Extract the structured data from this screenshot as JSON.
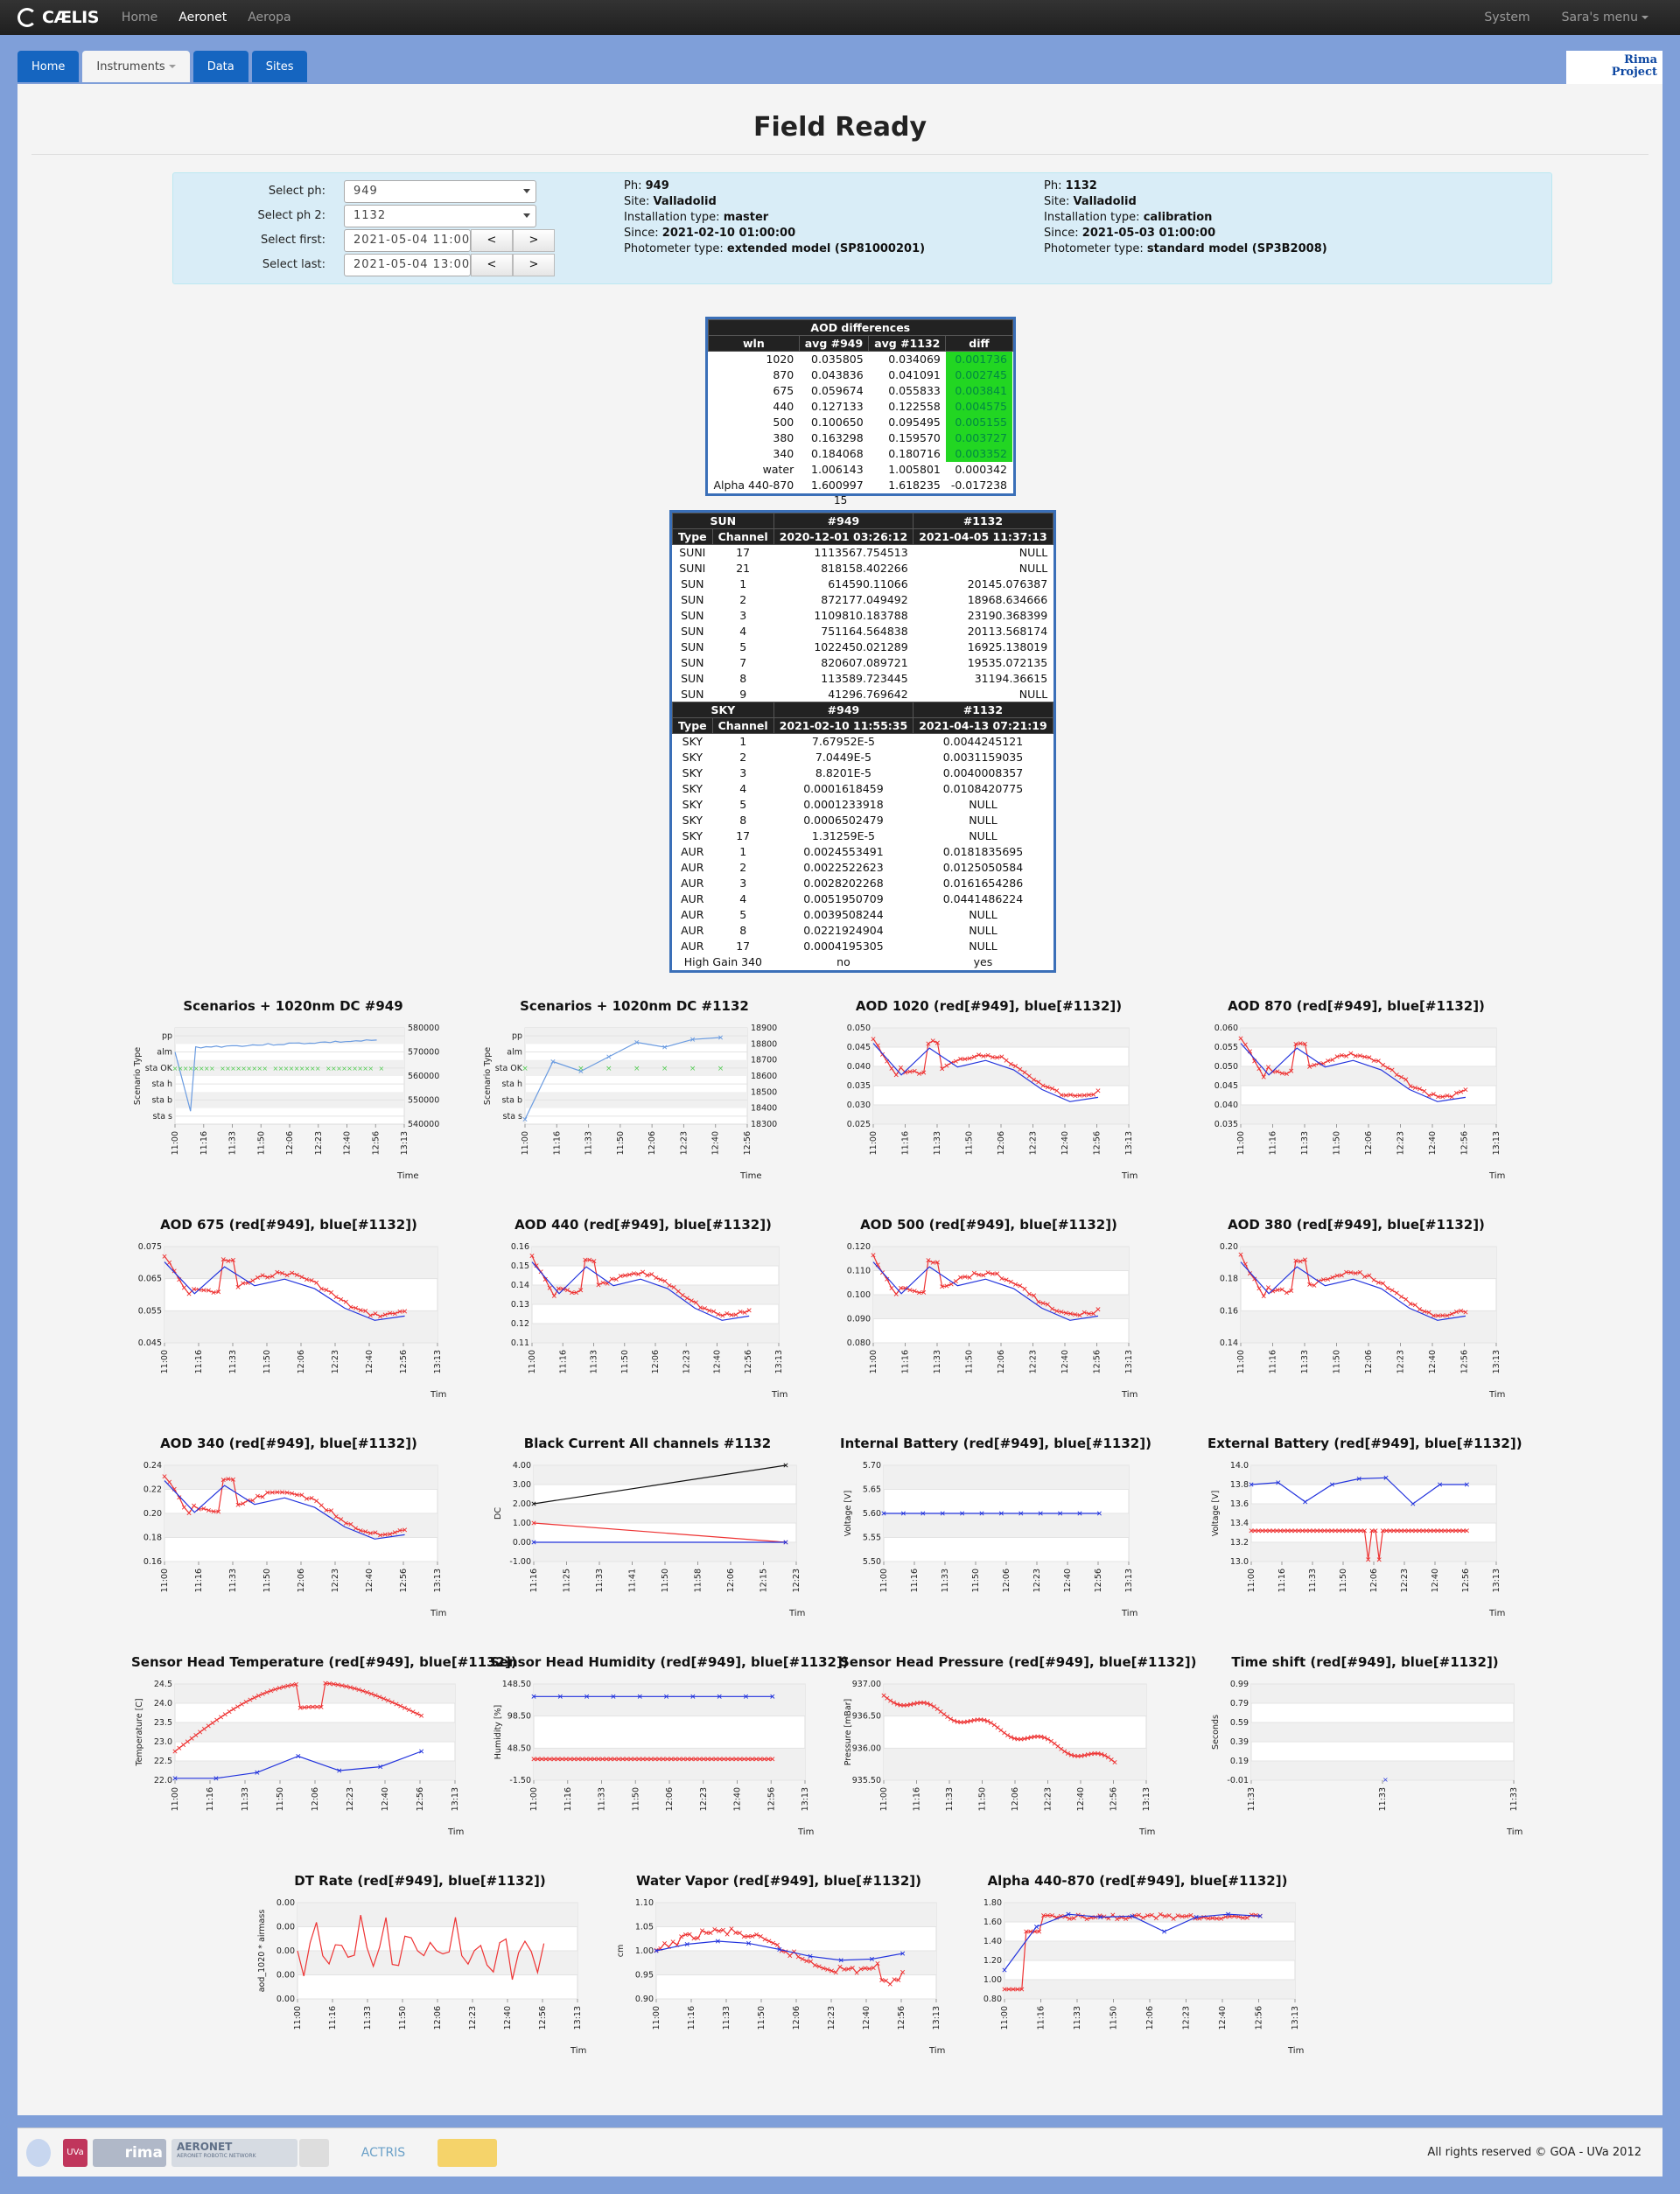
{
  "nav": {
    "brand": "CÆLIS",
    "items": [
      "Home",
      "Aeronet",
      "Aeropa"
    ],
    "right": [
      "System",
      "Sara's menu"
    ]
  },
  "tabs": [
    "Home",
    "Instruments",
    "Data",
    "Sites"
  ],
  "rima": [
    "Rima",
    "Project"
  ],
  "title": "Field Ready",
  "form": {
    "ph_label": "Select ph:",
    "ph": "949",
    "ph2_label": "Select ph 2:",
    "ph2": "1132",
    "first_label": "Select first:",
    "first": "2021-05-04 11:00:00",
    "last_label": "Select last:",
    "last": "2021-05-04 13:00:00",
    "prev": "<",
    "next": ">"
  },
  "ph1": {
    "ph_l": "Ph:",
    "ph": "949",
    "site_l": "Site:",
    "site": "Valladolid",
    "inst_l": "Installation type:",
    "inst": "master",
    "since_l": "Since:",
    "since": "2021-02-10 01:00:00",
    "type_l": "Photometer type:",
    "type": "extended model (SP81000201)"
  },
  "ph2": {
    "ph_l": "Ph:",
    "ph": "1132",
    "site_l": "Site:",
    "site": "Valladolid",
    "inst_l": "Installation type:",
    "inst": "calibration",
    "since_l": "Since:",
    "since": "2021-05-03 01:00:00",
    "type_l": "Photometer type:",
    "type": "standard model (SP3B2008)"
  },
  "aod_table": {
    "title": "AOD differences",
    "headers": [
      "wln",
      "avg #949",
      "avg #1132",
      "diff"
    ],
    "rows": [
      [
        "1020",
        "0.035805",
        "0.034069",
        "0.001736",
        true
      ],
      [
        "870",
        "0.043836",
        "0.041091",
        "0.002745",
        true
      ],
      [
        "675",
        "0.059674",
        "0.055833",
        "0.003841",
        true
      ],
      [
        "440",
        "0.127133",
        "0.122558",
        "0.004575",
        true
      ],
      [
        "500",
        "0.100650",
        "0.095495",
        "0.005155",
        true
      ],
      [
        "380",
        "0.163298",
        "0.159570",
        "0.003727",
        true
      ],
      [
        "340",
        "0.184068",
        "0.180716",
        "0.003352",
        true
      ],
      [
        "water",
        "1.006143",
        "1.005801",
        "0.000342",
        false
      ],
      [
        "Alpha 440-870",
        "1.600997",
        "1.618235",
        "-0.017238",
        false
      ]
    ]
  },
  "count": "15",
  "sun_table": {
    "h1": [
      "SUN",
      "#949",
      "#1132"
    ],
    "h2": [
      "Type",
      "Channel",
      "2020-12-01 03:26:12",
      "2021-04-05 11:37:13"
    ],
    "rows": [
      [
        "SUNI",
        "17",
        "1113567.754513",
        "NULL"
      ],
      [
        "SUNI",
        "21",
        "818158.402266",
        "NULL"
      ],
      [
        "SUN",
        "1",
        "614590.11066",
        "20145.076387"
      ],
      [
        "SUN",
        "2",
        "872177.049492",
        "18968.634666"
      ],
      [
        "SUN",
        "3",
        "1109810.183788",
        "23190.368399"
      ],
      [
        "SUN",
        "4",
        "751164.564838",
        "20113.568174"
      ],
      [
        "SUN",
        "5",
        "1022450.021289",
        "16925.138019"
      ],
      [
        "SUN",
        "7",
        "820607.089721",
        "19535.072135"
      ],
      [
        "SUN",
        "8",
        "113589.723445",
        "31194.36615"
      ],
      [
        "SUN",
        "9",
        "41296.769642",
        "NULL"
      ]
    ],
    "sky_h1": [
      "SKY",
      "#949",
      "#1132"
    ],
    "sky_h2": [
      "Type",
      "Channel",
      "2021-02-10 11:55:35",
      "2021-04-13 07:21:19"
    ],
    "sky_rows": [
      [
        "SKY",
        "1",
        "7.67952E-5",
        "0.0044245121"
      ],
      [
        "SKY",
        "2",
        "7.0449E-5",
        "0.0031159035"
      ],
      [
        "SKY",
        "3",
        "8.8201E-5",
        "0.0040008357"
      ],
      [
        "SKY",
        "4",
        "0.0001618459",
        "0.0108420775"
      ],
      [
        "SKY",
        "5",
        "0.0001233918",
        "NULL"
      ],
      [
        "SKY",
        "8",
        "0.0006502479",
        "NULL"
      ],
      [
        "SKY",
        "17",
        "1.31259E-5",
        "NULL"
      ],
      [
        "AUR",
        "1",
        "0.0024553491",
        "0.0181835695"
      ],
      [
        "AUR",
        "2",
        "0.0022522623",
        "0.0125050584"
      ],
      [
        "AUR",
        "3",
        "0.0028202268",
        "0.0161654286"
      ],
      [
        "AUR",
        "4",
        "0.0051950709",
        "0.0441486224"
      ],
      [
        "AUR",
        "5",
        "0.0039508244",
        "NULL"
      ],
      [
        "AUR",
        "8",
        "0.0221924904",
        "NULL"
      ],
      [
        "AUR",
        "17",
        "0.0004195305",
        "NULL"
      ]
    ],
    "gain": [
      "High Gain 340",
      "no",
      "yes"
    ]
  },
  "time_ticks": [
    "11:00",
    "11:16",
    "11:33",
    "11:50",
    "12:06",
    "12:23",
    "12:40",
    "12:56",
    "13:13"
  ],
  "time_label": "Time",
  "charts": [
    {
      "title": "Scenarios + 1020nm DC #949",
      "ylabel": "Scenario Type",
      "cats": [
        "pp",
        "alm",
        "sta OK",
        "sta h",
        "sta b",
        "sta s"
      ],
      "y2": [
        "580000",
        "570000",
        "560000",
        "550000",
        "540000"
      ],
      "xticks": [
        "11:00",
        "11:16",
        "11:33",
        "11:50",
        "12:06",
        "12:23",
        "12:40",
        "12:56",
        "13:13"
      ],
      "kind": "scen",
      "c1": "#6a9be0"
    },
    {
      "title": "Scenarios + 1020nm DC #1132",
      "ylabel": "Scenario Type",
      "cats": [
        "pp",
        "alm",
        "sta OK",
        "sta h",
        "sta b",
        "sta s"
      ],
      "y2": [
        "18900",
        "18800",
        "18700",
        "18600",
        "18500",
        "18400",
        "18300"
      ],
      "xticks": [
        "11:00",
        "11:16",
        "11:33",
        "11:50",
        "12:06",
        "12:23",
        "12:40",
        "12:56"
      ],
      "kind": "scen2",
      "c1": "#6a9be0"
    },
    {
      "title": "AOD 1020 (red[#949], blue[#1132])",
      "yt": [
        "0.050",
        "0.045",
        "0.040",
        "0.035",
        "0.030",
        "0.025"
      ],
      "kind": "aod",
      "seed": 1
    },
    {
      "title": "AOD 870 (red[#949], blue[#1132])",
      "yt": [
        "0.060",
        "0.055",
        "0.050",
        "0.045",
        "0.040",
        "0.035"
      ],
      "kind": "aod",
      "seed": 2
    },
    {
      "title": "AOD 675 (red[#949], blue[#1132])",
      "yt": [
        "0.075",
        "0.065",
        "0.055",
        "0.045"
      ],
      "kind": "aod",
      "seed": 3
    },
    {
      "title": "AOD 440 (red[#949], blue[#1132])",
      "yt": [
        "0.16",
        "0.15",
        "0.14",
        "0.13",
        "0.12",
        "0.11"
      ],
      "kind": "aod",
      "seed": 4
    },
    {
      "title": "AOD 500 (red[#949], blue[#1132])",
      "yt": [
        "0.120",
        "0.110",
        "0.100",
        "0.090",
        "0.080"
      ],
      "kind": "aod",
      "seed": 5
    },
    {
      "title": "AOD 380 (red[#949], blue[#1132])",
      "yt": [
        "0.20",
        "0.18",
        "0.16",
        "0.14"
      ],
      "kind": "aod",
      "seed": 6
    },
    {
      "title": "AOD 340 (red[#949], blue[#1132])",
      "yt": [
        "0.24",
        "0.22",
        "0.20",
        "0.18",
        "0.16"
      ],
      "kind": "aod",
      "seed": 7
    },
    {
      "title": "Black Current All channels #1132",
      "ylabel": "DC",
      "yt": [
        "4.00",
        "3.00",
        "2.00",
        "1.00",
        "0.00",
        "-1.00"
      ],
      "xticks": [
        "11:16",
        "11:25",
        "11:33",
        "11:41",
        "11:50",
        "11:58",
        "12:06",
        "12:15",
        "12:23"
      ],
      "kind": "bc"
    },
    {
      "title": "Internal Battery (red[#949], blue[#1132])",
      "ylabel": "Voltage [V]",
      "yt": [
        "5.70",
        "5.65",
        "5.60",
        "5.55",
        "5.50"
      ],
      "kind": "ib"
    },
    {
      "title": "External Battery (red[#949], blue[#1132])",
      "ylabel": "Voltage [V]",
      "yt": [
        "14.0",
        "13.8",
        "13.6",
        "13.4",
        "13.2",
        "13.0"
      ],
      "kind": "eb"
    },
    {
      "title": "Sensor Head Temperature (red[#949], blue[#1132])",
      "ylabel": "Temperature [C]",
      "yt": [
        "24.5",
        "24.0",
        "23.5",
        "23.0",
        "22.5",
        "22.0"
      ],
      "kind": "temp"
    },
    {
      "title": "Sensor Head Humidity (red[#949], blue[#1132])",
      "ylabel": "Humidity [%]",
      "yt": [
        "148.50",
        "98.50",
        "48.50",
        "-1.50"
      ],
      "kind": "hum"
    },
    {
      "title": "Sensor Head Pressure (red[#949], blue[#1132])",
      "ylabel": "Pressure [mBar]",
      "yt": [
        "937.00",
        "936.50",
        "936.00",
        "935.50"
      ],
      "kind": "pres"
    },
    {
      "title": "Time shift (red[#949], blue[#1132])",
      "ylabel": "Seconds",
      "yt": [
        "0.99",
        "0.79",
        "0.59",
        "0.39",
        "0.19",
        "-0.01"
      ],
      "xticks": [
        "11:33",
        "11:33",
        "11:33"
      ],
      "kind": "ts"
    },
    {
      "title": "DT Rate (red[#949], blue[#1132])",
      "ylabel": "aod_1020 * airmass",
      "yt": [
        "0.00",
        "0.00",
        "0.00",
        "0.00",
        "0.00"
      ],
      "kind": "dt"
    },
    {
      "title": "Water Vapor (red[#949], blue[#1132])",
      "ylabel": "cm",
      "yt": [
        "1.10",
        "1.05",
        "1.00",
        "0.95",
        "0.90"
      ],
      "kind": "wv"
    },
    {
      "title": "Alpha 440-870 (red[#949], blue[#1132])",
      "yt": [
        "1.80",
        "1.60",
        "1.40",
        "1.20",
        "1.00",
        "0.80"
      ],
      "kind": "alpha"
    }
  ],
  "footer": {
    "copy": "All rights reserved © GOA - UVa 2012",
    "logos": [
      "UVa",
      "rima",
      "AERONET",
      "AERONET ROBOTIC NETWORK",
      "ACTRIS"
    ]
  }
}
